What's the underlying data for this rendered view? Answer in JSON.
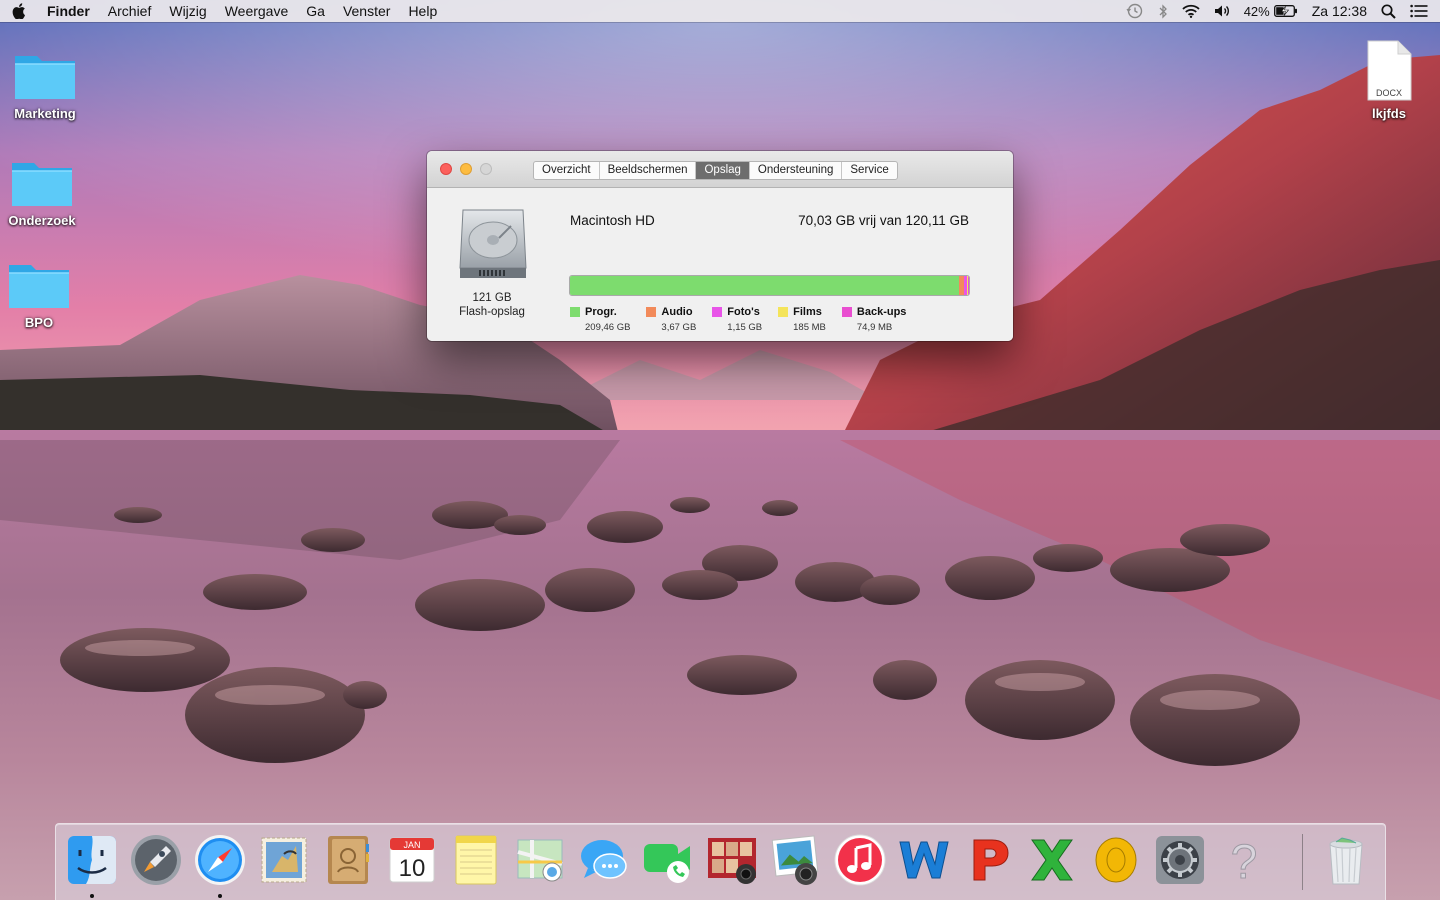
{
  "menubar": {
    "app_name": "Finder",
    "menus": [
      "Archief",
      "Wijzig",
      "Weergave",
      "Ga",
      "Venster",
      "Help"
    ],
    "battery_percent": "42%",
    "clock": "Za 12:38"
  },
  "desktop": {
    "folders": [
      {
        "label": "Marketing"
      },
      {
        "label": "Onderzoek"
      },
      {
        "label": "BPO"
      }
    ],
    "file": {
      "label": "lkjfds",
      "extension": "DOCX"
    }
  },
  "about_window": {
    "tabs": [
      "Overzicht",
      "Beeldschermen",
      "Opslag",
      "Ondersteuning",
      "Service"
    ],
    "active_tab": "Opslag",
    "drive": {
      "size": "121 GB",
      "type": "Flash-opslag"
    },
    "volume": {
      "name": "Macintosh HD",
      "free_text": "70,03 GB vrij van 120,11 GB",
      "usage_fractions": {
        "progr": 0.975,
        "audio": 0.012,
        "fotos": 0.008,
        "films": 0.002,
        "backups": 0.003
      }
    },
    "legend": [
      {
        "label": "Progr.",
        "value": "209,46 GB",
        "color": "#7ddc6e"
      },
      {
        "label": "Audio",
        "value": "3,67 GB",
        "color": "#f28a5a"
      },
      {
        "label": "Foto's",
        "value": "1,15 GB",
        "color": "#e854e8"
      },
      {
        "label": "Films",
        "value": "185 MB",
        "color": "#f4e45a"
      },
      {
        "label": "Back-ups",
        "value": "74,9 MB",
        "color": "#e94ed0"
      }
    ]
  },
  "dock": {
    "items": [
      "Finder",
      "Launchpad",
      "Safari",
      "Mail",
      "Contacten",
      "Agenda",
      "Notities",
      "Kaarten",
      "Berichten",
      "FaceTime",
      "Photo Booth",
      "iPhoto",
      "iTunes",
      "Word",
      "PowerPoint",
      "Excel",
      "Outlook",
      "Systeemvoorkeuren",
      "Onbekend",
      "Prullenmand"
    ],
    "calendar_month": "JAN",
    "calendar_day": "10",
    "unknown_glyph": "?"
  }
}
